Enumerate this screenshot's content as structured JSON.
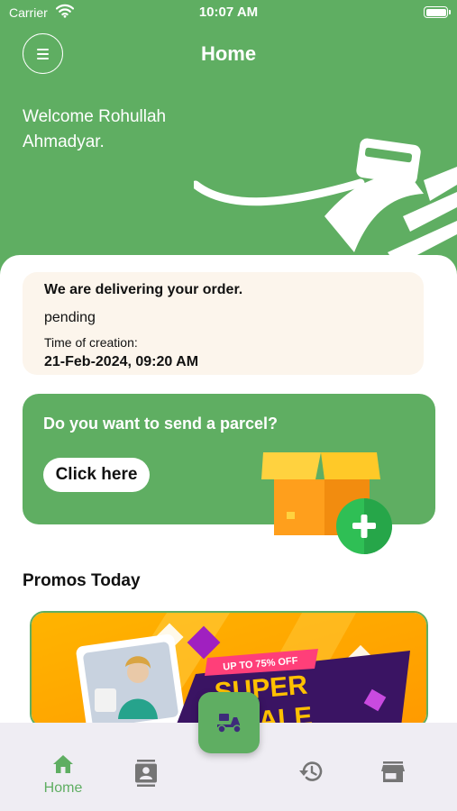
{
  "status_bar": {
    "carrier": "Carrier",
    "time": "10:07 AM"
  },
  "header": {
    "title": "Home",
    "welcome": "Welcome Rohullah Ahmadyar."
  },
  "order": {
    "title": "We are delivering your order.",
    "status": "pending",
    "time_label": "Time of creation:",
    "time_value": "21-Feb-2024, 09:20 AM"
  },
  "parcel": {
    "question": "Do you want to send a parcel?",
    "button_label": "Click here"
  },
  "promos": {
    "heading": "Promos Today",
    "banner": {
      "tag": "UP TO 75% OFF",
      "headline_1": "SUPER",
      "headline_2": "SALE"
    }
  },
  "bottom_nav": {
    "items": [
      {
        "label": "Home",
        "icon": "home-icon",
        "active": true
      },
      {
        "label": "",
        "icon": "contacts-icon",
        "active": false
      },
      {
        "label": "",
        "icon": "delivery-scooter-icon",
        "active": false
      },
      {
        "label": "",
        "icon": "history-icon",
        "active": false
      },
      {
        "label": "",
        "icon": "store-icon",
        "active": false
      }
    ]
  },
  "colors": {
    "brand_green": "#5fae62",
    "order_card_bg": "#fcf5ec",
    "nav_bg": "#efedf3",
    "icon_gray": "#757575"
  }
}
